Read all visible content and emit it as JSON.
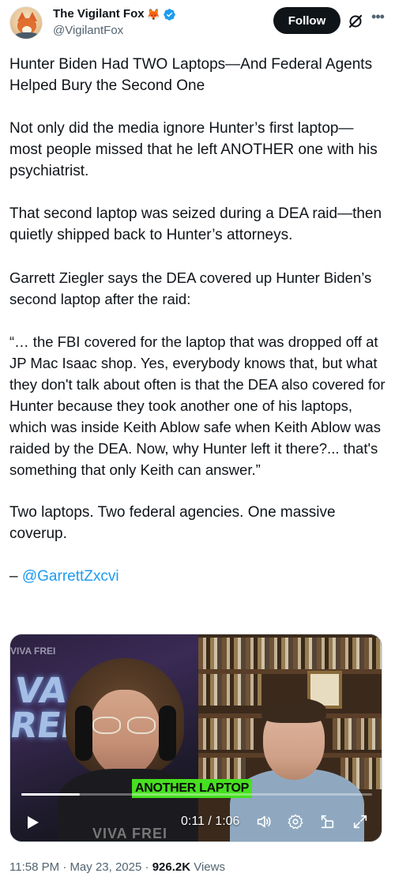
{
  "author": {
    "display_name": "The Vigilant Fox",
    "emoji": "🦊",
    "handle": "@VigilantFox",
    "verified": true
  },
  "header": {
    "follow_label": "Follow",
    "grok_icon": "grok-slash-icon",
    "more_icon": "more-horizontal-icon"
  },
  "tweet": {
    "p1": "Hunter Biden Had TWO Laptops—And Federal Agents Helped Bury the Second One",
    "p2": "Not only did the media ignore Hunter’s first laptop—most people missed that he left ANOTHER one with his psychiatrist.",
    "p3": "That second laptop was seized during a DEA raid—then quietly shipped back to Hunter’s attorneys.",
    "p4": "Garrett Ziegler says the DEA covered up Hunter Biden’s second laptop after the raid:",
    "p5": "“… the FBI covered for the laptop that was dropped off at JP Mac Isaac shop. Yes, everybody knows that, but what they don't talk about often is that the DEA also covered for Hunter because they took another one of his laptops, which was inside Keith Ablow safe when Keith Ablow was raided by the DEA. Now, why Hunter left it there?... that's something that only Keith can answer.”",
    "p6": "Two laptops. Two federal agencies. One massive coverup.",
    "attribution_prefix": "– ",
    "mention": "@GarrettZxcvi"
  },
  "video": {
    "caption": "ANOTHER LAPTOP",
    "time": "0:11 / 1:06",
    "progress": 0.166,
    "backdrop_sign": "VIVA FREI",
    "neon_text": "VA\nREI",
    "shirt_text": "VIVA FREI",
    "controls": [
      "play-icon",
      "volume-icon",
      "settings-gear-icon",
      "pip-icon",
      "fullscreen-icon"
    ]
  },
  "meta": {
    "time": "11:58 PM",
    "sep": " · ",
    "date": "May 23, 2025",
    "views_count": "926.2K",
    "views_label": " Views"
  },
  "colors": {
    "accent": "#1d9bf0",
    "text": "#0f1419",
    "muted": "#536471",
    "caption_bg": "#46e020"
  }
}
